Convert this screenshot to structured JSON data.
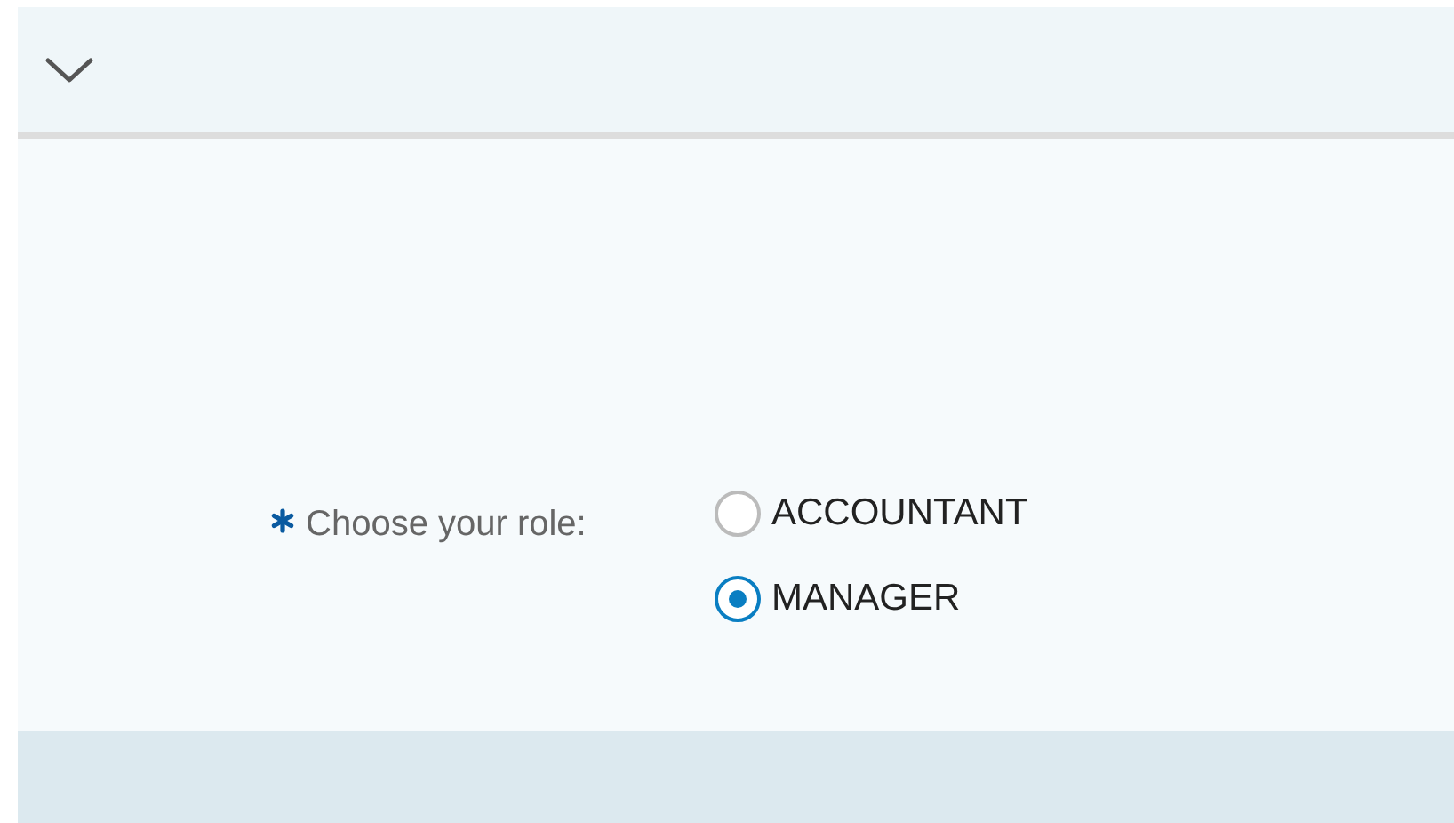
{
  "header": {
    "expanded": true
  },
  "role_field": {
    "label": "Choose your role:",
    "required": true,
    "options": [
      {
        "label": "ACCOUNTANT",
        "selected": false
      },
      {
        "label": "MANAGER",
        "selected": true
      }
    ]
  }
}
